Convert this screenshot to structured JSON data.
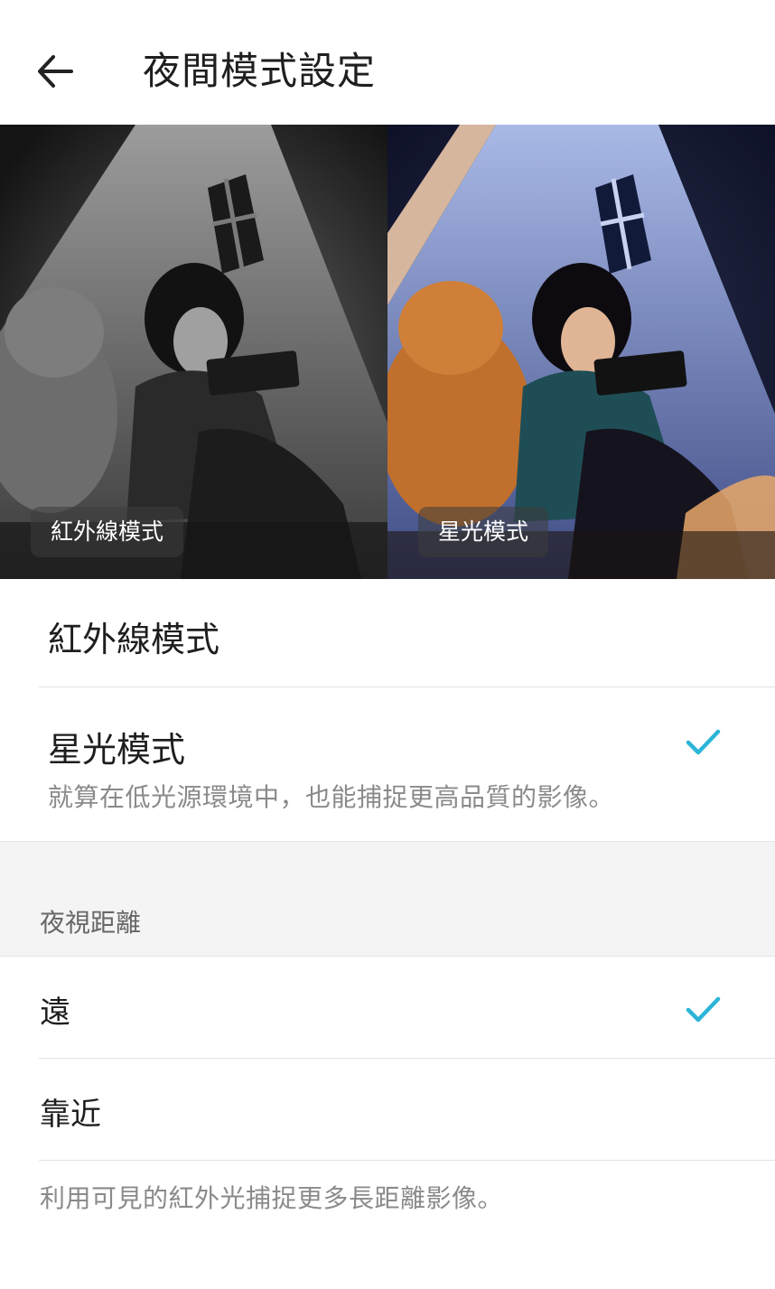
{
  "header": {
    "title": "夜間模式設定",
    "back_icon": "arrow-left-icon"
  },
  "preview": {
    "infrared_tag": "紅外線模式",
    "starlight_tag": "星光模式"
  },
  "night_mode": {
    "options": [
      {
        "label": "紅外線模式",
        "selected": false
      },
      {
        "label": "星光模式",
        "description": "就算在低光源環境中，也能捕捉更高品質的影像。",
        "selected": true
      }
    ]
  },
  "night_vision_distance": {
    "section_title": "夜視距離",
    "options": [
      {
        "label": "遠",
        "selected": true
      },
      {
        "label": "靠近",
        "selected": false
      }
    ],
    "footer_note": "利用可見的紅外光捕捉更多長距離影像。"
  },
  "colors": {
    "accent": "#2bb5d8",
    "divider": "#e2e2e2",
    "section_bg": "#f4f4f4",
    "secondary_text": "#8a8a8a"
  }
}
